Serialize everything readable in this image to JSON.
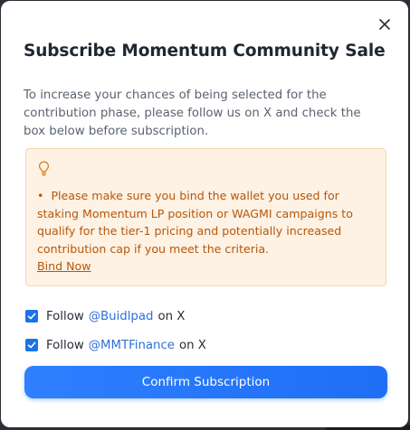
{
  "modal": {
    "title": "Subscribe Momentum Community Sale",
    "intro": "To increase your chances of being selected for the contribution phase, please follow us on X and check the box below before subscription.",
    "notice": {
      "icon": "lightbulb-icon",
      "bullet": "•",
      "text": "Please make sure you bind the wallet you used for staking Momentum LP position or WAGMI campaigns to qualify for the tier-1 pricing and potentially increased contribution cap if you meet the criteria.",
      "link_label": "Bind Now"
    },
    "follows": [
      {
        "prefix": "Follow",
        "handle": "@Buidlpad",
        "suffix": "on X",
        "checked": true
      },
      {
        "prefix": "Follow",
        "handle": "@MMTFinance",
        "suffix": "on X",
        "checked": true
      }
    ],
    "confirm_label": "Confirm Subscription",
    "close_icon": "close-icon"
  },
  "colors": {
    "accent": "#1f6ef5",
    "notice_bg": "#fdf2e4",
    "notice_text": "#b8560a",
    "link": "#2f6fd8"
  }
}
